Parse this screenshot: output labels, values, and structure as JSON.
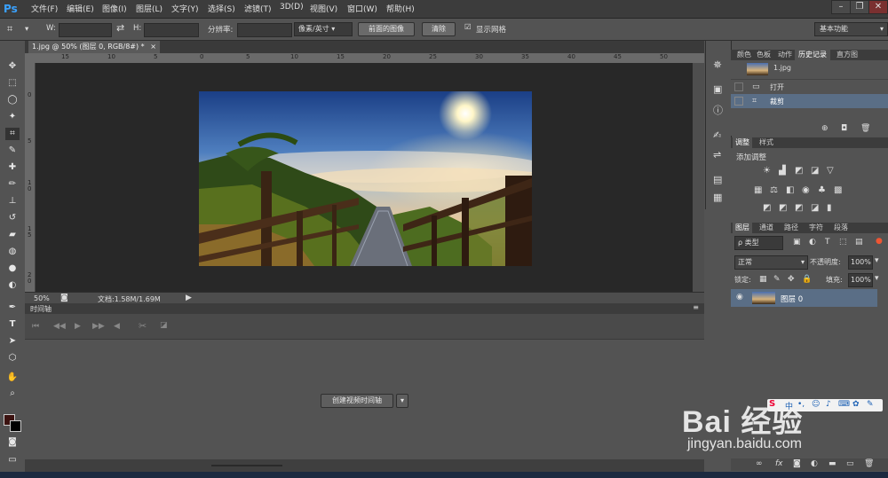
{
  "app": {
    "logo": "Ps"
  },
  "menu": [
    "文件(F)",
    "编辑(E)",
    "图像(I)",
    "图层(L)",
    "文字(Y)",
    "选择(S)",
    "滤镜(T)",
    "3D(D)",
    "视图(V)",
    "窗口(W)",
    "帮助(H)"
  ],
  "window_controls": [
    "–",
    "❐",
    "✕"
  ],
  "options": {
    "w_label": "W:",
    "h_label": "H:",
    "resolution_label": "分辨率:",
    "unit_select": "像素/英寸",
    "front_image_button": "前面的图像",
    "clear_button": "清除",
    "grid_checkbox_label": "显示网格",
    "workspace_select": "基本功能"
  },
  "document": {
    "tab_title": "1.jpg @ 50% (图层 0, RGB/8#) *",
    "tab_close": "×",
    "ruler_top": [
      "15",
      "10",
      "5",
      "0",
      "5",
      "10",
      "15",
      "20",
      "25",
      "30",
      "35",
      "40",
      "45",
      "50"
    ],
    "ruler_left": [
      "0",
      "5",
      "1\n0",
      "1\n5",
      "2\n0"
    ],
    "zoom": "50%",
    "doc_info": "文档:1.58M/1.69M"
  },
  "timeline": {
    "title": "时间轴",
    "create_button": "创建视频时间轴"
  },
  "history_panel": {
    "tabs": [
      "颜色",
      "色板",
      "动作",
      "历史记录",
      "直方图"
    ],
    "active_tab": 3,
    "snapshot_label": "1.jpg",
    "items": [
      "打开",
      "裁剪"
    ]
  },
  "adjustments_panel": {
    "tabs": [
      "调整",
      "样式"
    ],
    "title": "添加调整"
  },
  "layers_panel": {
    "tabs": [
      "图层",
      "通道",
      "路径",
      "字符",
      "段落"
    ],
    "kind_select": "ρ 类型",
    "blend_mode": "正常",
    "opacity_label": "不透明度:",
    "opacity_value": "100%",
    "lock_label": "锁定:",
    "fill_label": "填充:",
    "fill_value": "100%",
    "layer_name": "图层 0"
  },
  "watermark": {
    "brand": "Bai 经验",
    "url": "jingyan.baidu.com"
  }
}
